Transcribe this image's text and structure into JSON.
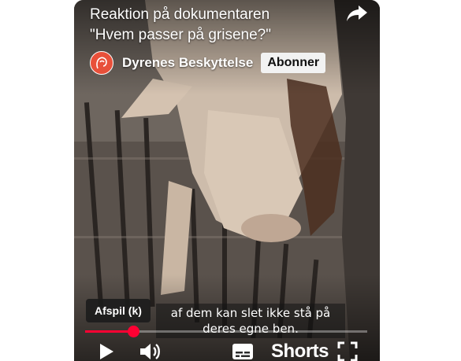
{
  "video": {
    "title_line1": "Reaktion på dokumentaren",
    "title_line2": "\"Hvem passer på grisene?\"",
    "channel_name": "Dyrenes Beskyttelse",
    "subscribe_label": "Abonner",
    "caption_line1": "af dem kan slet ikke stå på",
    "caption_line2": "deres egne ben.",
    "tooltip": "Afspil (k)",
    "progress_fraction": 0.17,
    "accent_color": "#ff0033"
  },
  "controls": {
    "shorts_label": "Shorts",
    "icons": [
      "share-icon",
      "play-icon",
      "volume-icon",
      "captions-icon",
      "fullscreen-icon"
    ]
  }
}
